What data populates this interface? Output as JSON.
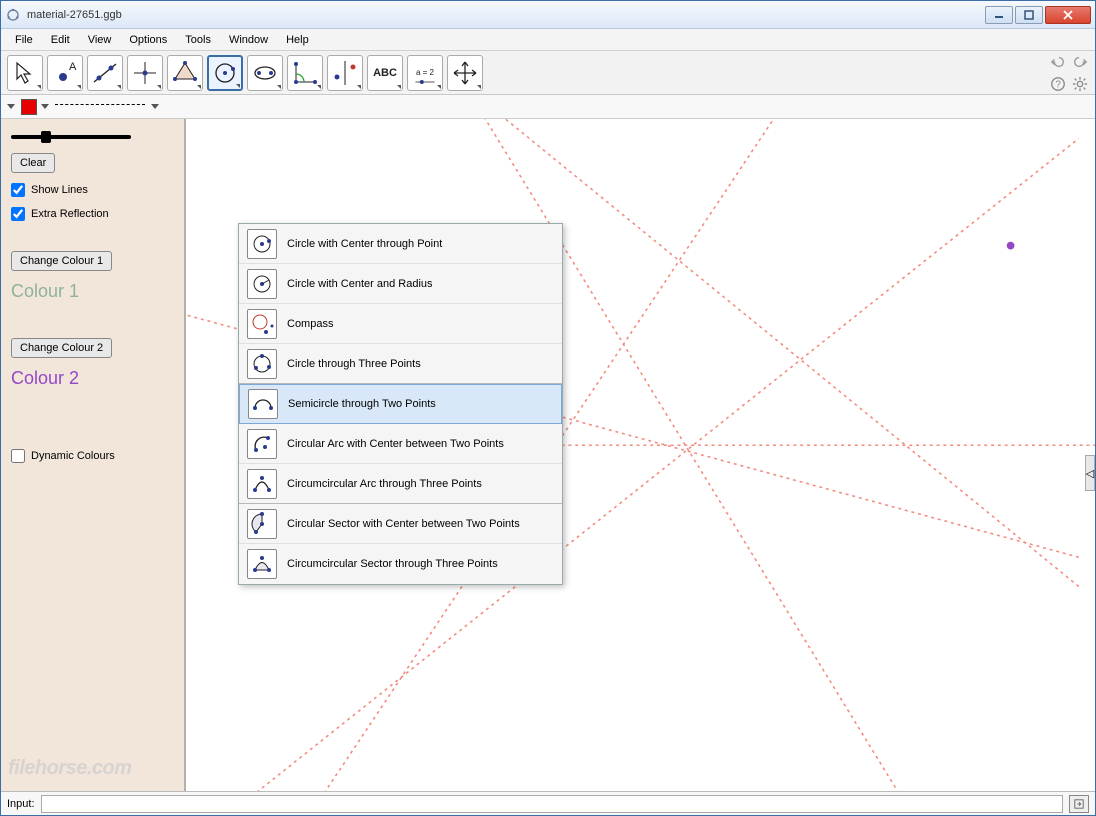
{
  "window": {
    "title": "material-27651.ggb"
  },
  "menu": {
    "items": [
      "File",
      "Edit",
      "View",
      "Options",
      "Tools",
      "Window",
      "Help"
    ]
  },
  "toolbar": {
    "tools": [
      "move",
      "point",
      "line",
      "linetype",
      "polygon",
      "circle",
      "ellipse",
      "angle",
      "reflect",
      "text",
      "slider",
      "pan"
    ],
    "selected_index": 5,
    "text_label": "ABC",
    "slider_label": "a = 2"
  },
  "stylebar": {
    "color": "#e60000"
  },
  "sidebar": {
    "clear_btn": "Clear",
    "show_lines": "Show Lines",
    "extra_reflection": "Extra Reflection",
    "change_colour_1": "Change Colour 1",
    "colour1_label": "Colour 1",
    "change_colour_2": "Change Colour 2",
    "colour2_label": "Colour 2",
    "dynamic_colours": "Dynamic Colours"
  },
  "dropdown": {
    "items": [
      {
        "label": "Circle with Center through Point",
        "sep": false
      },
      {
        "label": "Circle with Center and Radius",
        "sep": false
      },
      {
        "label": "Compass",
        "sep": false
      },
      {
        "label": "Circle through Three Points",
        "sep": true
      },
      {
        "label": "Semicircle through Two Points",
        "sep": false,
        "hover": true
      },
      {
        "label": "Circular Arc with Center between Two Points",
        "sep": false
      },
      {
        "label": "Circumcircular Arc through Three Points",
        "sep": true
      },
      {
        "label": "Circular Sector with Center between Two Points",
        "sep": false
      },
      {
        "label": "Circumcircular Sector through Three Points",
        "sep": false
      }
    ]
  },
  "inputbar": {
    "label": "Input:",
    "value": ""
  },
  "watermark": "filehorse.com"
}
